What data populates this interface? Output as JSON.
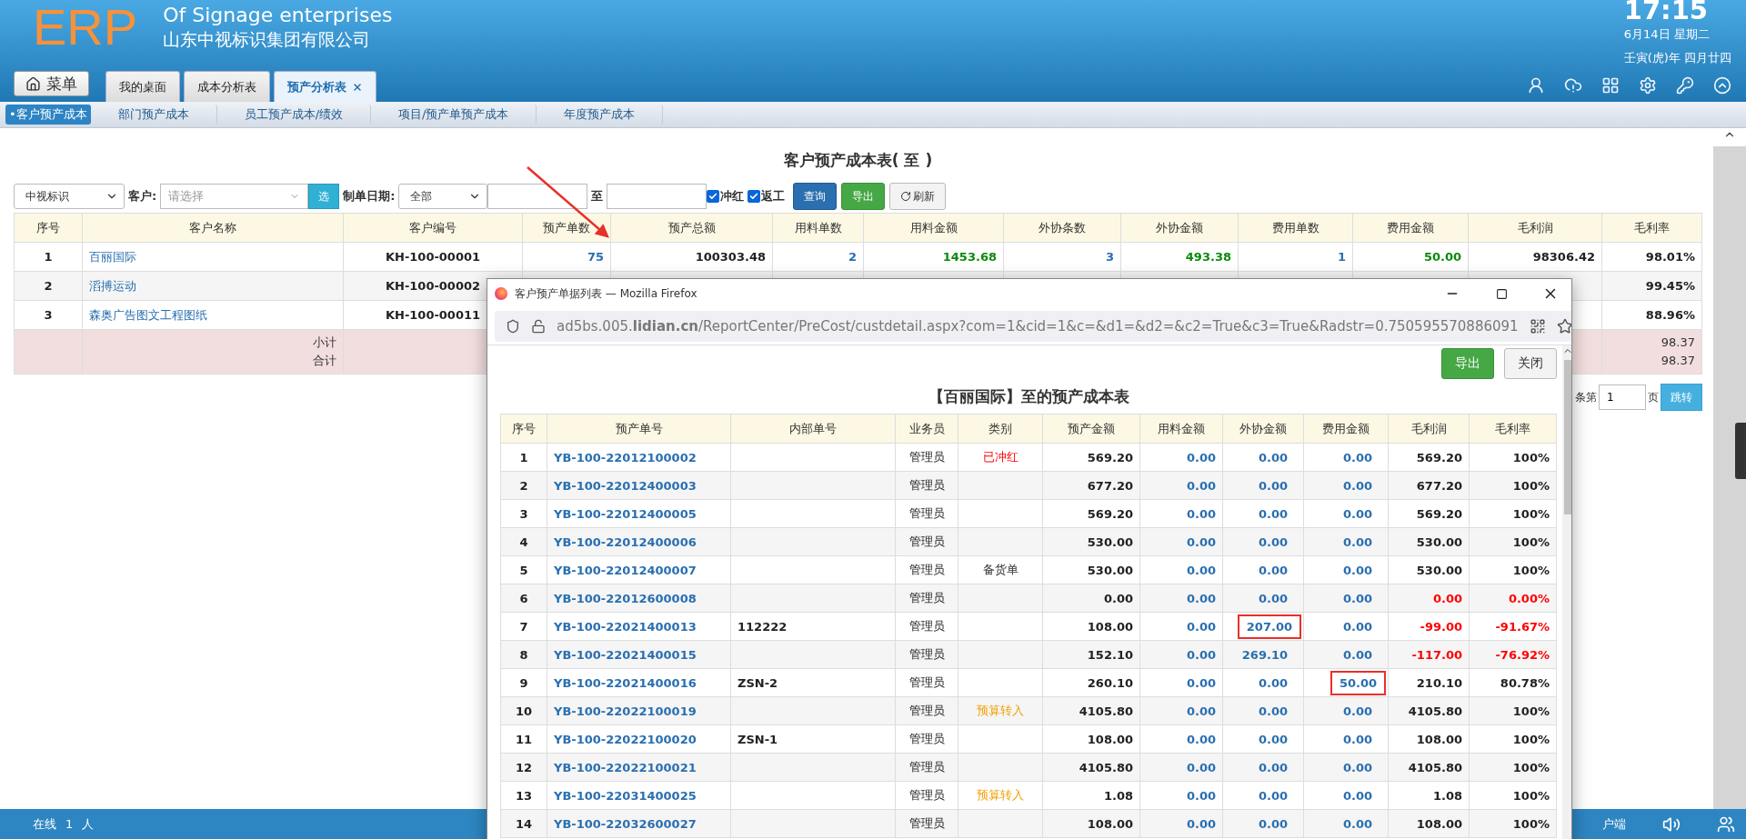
{
  "header": {
    "logo": "ERP",
    "tagline": "Of Signage enterprises",
    "company": "山东中视标识集团有限公司",
    "time": "17:15",
    "date": "6月14日 星期二",
    "lunar": "壬寅(虎)年 四月廿四",
    "menu_button": "菜单"
  },
  "tabs": [
    {
      "label": "我的桌面",
      "selected": false,
      "closable": false
    },
    {
      "label": "成本分析表",
      "selected": false,
      "closable": false
    },
    {
      "label": "预产分析表",
      "selected": true,
      "closable": true
    }
  ],
  "subnav": [
    {
      "label": "•客户预产成本",
      "selected": true
    },
    {
      "label": "部门预产成本",
      "selected": false
    },
    {
      "label": "员工预产成本/绩效",
      "selected": false
    },
    {
      "label": "项目/预产单预产成本",
      "selected": false
    },
    {
      "label": "年度预产成本",
      "selected": false
    }
  ],
  "report": {
    "title": "客户预产成本表( 至 )",
    "filters": {
      "company": "中视标识",
      "customer_label": "客户:",
      "customer_placeholder": "请选择",
      "select_button": "选",
      "date_label": "制单日期:",
      "date_range": "全部",
      "to_label": "至",
      "checks": [
        {
          "label": "冲红",
          "checked": true
        },
        {
          "label": "返工",
          "checked": true
        }
      ],
      "buttons": [
        {
          "label": "查询",
          "kind": "primary"
        },
        {
          "label": "导出",
          "kind": "success"
        },
        {
          "label": "刷新",
          "kind": "refresh"
        }
      ]
    },
    "columns": [
      "序号",
      "客户名称",
      "客户编号",
      "预产单数",
      "预产总额",
      "用料单数",
      "用料金额",
      "外协条数",
      "外协金额",
      "费用单数",
      "费用金额",
      "毛利润",
      "毛利率"
    ],
    "rows": [
      [
        "1",
        "百丽国际",
        "KH-100-00001",
        "75",
        "100303.48",
        "2",
        "1453.68",
        "3",
        "493.38",
        "1",
        "50.00",
        "98306.42",
        "98.01%"
      ],
      [
        "2",
        "滔搏运动",
        "KH-100-00002",
        null,
        null,
        null,
        null,
        null,
        null,
        null,
        null,
        null,
        "99.45%"
      ],
      [
        "3",
        "森奥广告图文工程图纸",
        "KH-100-00011",
        null,
        null,
        null,
        null,
        null,
        null,
        null,
        null,
        null,
        "88.96%"
      ]
    ],
    "summary": {
      "labels": [
        "小计",
        "合计"
      ],
      "rates": [
        "98.37",
        "98.37"
      ]
    },
    "pagination": {
      "before": "条第",
      "page": "1",
      "after": "页",
      "button": "跳转"
    }
  },
  "status_bar": {
    "online_label": "在线",
    "online_count": "1",
    "online_unit": "人",
    "right_text": "户端"
  },
  "popup": {
    "window_title": "客户预产单据列表 — Mozilla Firefox",
    "url": "ad5bs.005.**lidian.cn**/ReportCenter/PreCost/custdetail.aspx?com=1&cid=1&c=&d1=&d2=&c2=True&c3=True&Radstr=0.750595570886091",
    "buttons": [
      {
        "label": "导出",
        "kind": "success"
      },
      {
        "label": "关闭",
        "kind": "default"
      }
    ],
    "title": "【百丽国际】至的预产成本表",
    "columns": [
      "序号",
      "预产单号",
      "内部单号",
      "业务员",
      "类别",
      "预产金额",
      "用料金额",
      "外协金额",
      "费用金额",
      "毛利润",
      "毛利率"
    ],
    "rows": [
      {
        "cells": [
          "1",
          "YB-100-22012100002",
          null,
          "管理员",
          "已冲红",
          "569.20",
          "0.00",
          "0.00",
          "0.00",
          "569.20",
          "100%"
        ],
        "color": "#ff0000",
        "loss": false,
        "outsource_boxed": false,
        "expense_boxed": false
      },
      {
        "cells": [
          "2",
          "YB-100-22012400003",
          null,
          "管理员",
          null,
          "677.20",
          "0.00",
          "0.00",
          "0.00",
          "677.20",
          "100%"
        ],
        "loss": false,
        "outsource_boxed": false,
        "expense_boxed": false
      },
      {
        "cells": [
          "3",
          "YB-100-22012400005",
          null,
          "管理员",
          null,
          "569.20",
          "0.00",
          "0.00",
          "0.00",
          "569.20",
          "100%"
        ],
        "loss": false,
        "outsource_boxed": false,
        "expense_boxed": false
      },
      {
        "cells": [
          "4",
          "YB-100-22012400006",
          null,
          "管理员",
          null,
          "530.00",
          "0.00",
          "0.00",
          "0.00",
          "530.00",
          "100%"
        ],
        "loss": false,
        "outsource_boxed": false,
        "expense_boxed": false
      },
      {
        "cells": [
          "5",
          "YB-100-22012400007",
          null,
          "管理员",
          "备货单",
          "530.00",
          "0.00",
          "0.00",
          "0.00",
          "530.00",
          "100%"
        ],
        "color": "#333333",
        "loss": false,
        "outsource_boxed": false,
        "expense_boxed": false
      },
      {
        "cells": [
          "6",
          "YB-100-22012600008",
          null,
          "管理员",
          null,
          "0.00",
          "0.00",
          "0.00",
          "0.00",
          "0.00",
          "0.00%"
        ],
        "loss": true,
        "outsource_boxed": false,
        "expense_boxed": false
      },
      {
        "cells": [
          "7",
          "YB-100-22021400013",
          "112222",
          "管理员",
          null,
          "108.00",
          "0.00",
          "207.00",
          "0.00",
          "-99.00",
          "-91.67%"
        ],
        "loss": true,
        "outsource_boxed": true,
        "expense_boxed": false
      },
      {
        "cells": [
          "8",
          "YB-100-22021400015",
          null,
          "管理员",
          null,
          "152.10",
          "0.00",
          "269.10",
          "0.00",
          "-117.00",
          "-76.92%"
        ],
        "loss": true,
        "outsource_boxed": false,
        "expense_boxed": false
      },
      {
        "cells": [
          "9",
          "YB-100-22021400016",
          "ZSN-2",
          "管理员",
          null,
          "260.10",
          "0.00",
          "0.00",
          "50.00",
          "210.10",
          "80.78%"
        ],
        "loss": false,
        "outsource_boxed": false,
        "expense_boxed": true
      },
      {
        "cells": [
          "10",
          "YB-100-22022100019",
          null,
          "管理员",
          "预算转入",
          "4105.80",
          "0.00",
          "0.00",
          "0.00",
          "4105.80",
          "100%"
        ],
        "color": "#f0a000",
        "loss": false,
        "outsource_boxed": false,
        "expense_boxed": false
      },
      {
        "cells": [
          "11",
          "YB-100-22022100020",
          "ZSN-1",
          "管理员",
          null,
          "108.00",
          "0.00",
          "0.00",
          "0.00",
          "108.00",
          "100%"
        ],
        "loss": false,
        "outsource_boxed": false,
        "expense_boxed": false
      },
      {
        "cells": [
          "12",
          "YB-100-22022100021",
          null,
          "管理员",
          null,
          "4105.80",
          "0.00",
          "0.00",
          "0.00",
          "4105.80",
          "100%"
        ],
        "loss": false,
        "outsource_boxed": false,
        "expense_boxed": false
      },
      {
        "cells": [
          "13",
          "YB-100-22031400025",
          null,
          "管理员",
          "预算转入",
          "1.08",
          "0.00",
          "0.00",
          "0.00",
          "1.08",
          "100%"
        ],
        "color": "#f0a000",
        "loss": false,
        "outsource_boxed": false,
        "expense_boxed": false
      },
      {
        "cells": [
          "14",
          "YB-100-22032600027",
          null,
          "管理员",
          null,
          "108.00",
          "0.00",
          "0.00",
          "0.00",
          "108.00",
          "100%"
        ],
        "loss": false,
        "outsource_boxed": false,
        "expense_boxed": false
      }
    ]
  }
}
